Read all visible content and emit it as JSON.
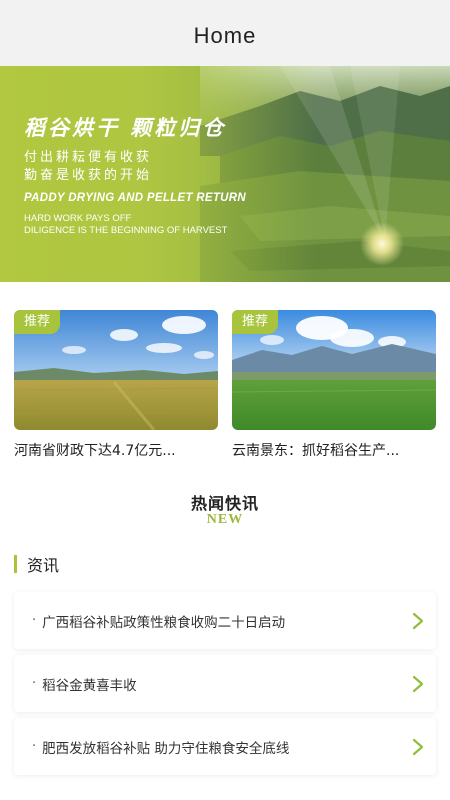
{
  "header": {
    "title": "Home"
  },
  "banner": {
    "title": "稻谷烘干 颗粒归仓",
    "line1": "付出耕耘便有收获",
    "line2": "勤奋是收获的开始",
    "en_title": "PADDY DRYING AND PELLET RETURN",
    "en_line1": "HARD WORK PAYS OFF",
    "en_line2": "DILIGENCE IS THE BEGINNING OF HARVEST"
  },
  "cards": [
    {
      "tag": "推荐",
      "title": "河南省财政下达4.7亿元..."
    },
    {
      "tag": "推荐",
      "title": "云南景东：抓好稻谷生产..."
    }
  ],
  "hot": {
    "title": "热闻快讯",
    "subtitle": "NEW"
  },
  "section": {
    "title": "资讯"
  },
  "news": [
    {
      "bullet": "·",
      "text": "广西稻谷补贴政策性粮食收购二十日启动"
    },
    {
      "bullet": "·",
      "text": "稻谷金黄喜丰收"
    },
    {
      "bullet": "·",
      "text": "肥西发放稻谷补贴 助力守住粮食安全底线"
    }
  ],
  "colors": {
    "accent": "#a8c43c",
    "header_bg": "#f2f2f2"
  }
}
